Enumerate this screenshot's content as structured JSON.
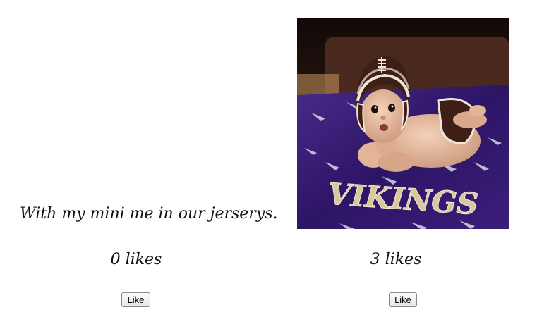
{
  "posts": [
    {
      "caption": "With my mini me in our jerserys.",
      "likes_text": "0 likes",
      "like_button": "Like"
    },
    {
      "photo_text": "VIKINGS",
      "likes_text": "3 likes",
      "like_button": "Like"
    }
  ]
}
